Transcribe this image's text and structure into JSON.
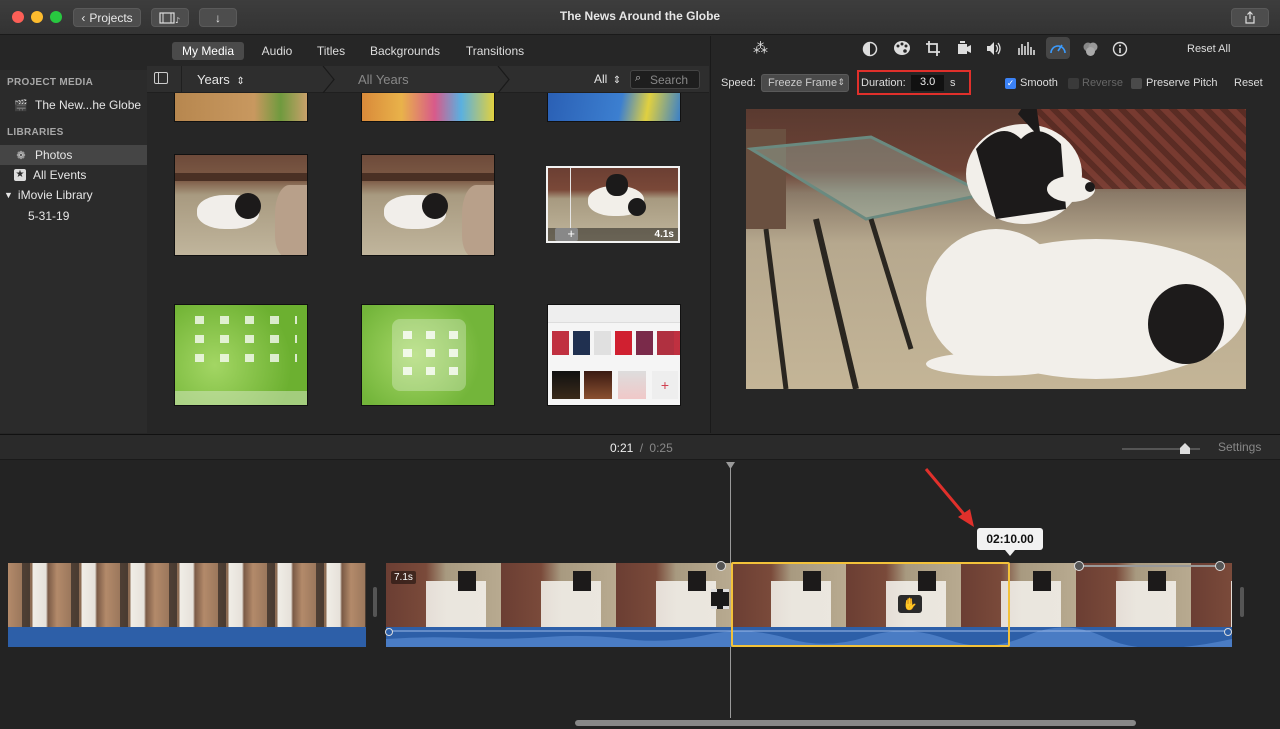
{
  "window": {
    "title": "The News Around the Globe",
    "projects_label": "Projects"
  },
  "browser": {
    "tabs": [
      "My Media",
      "Audio",
      "Titles",
      "Backgrounds",
      "Transitions"
    ],
    "active_tab": "My Media"
  },
  "sidebar": {
    "project_media_header": "PROJECT MEDIA",
    "project_item": "The New...he Globe",
    "libraries_header": "LIBRARIES",
    "photos": "Photos",
    "all_events": "All Events",
    "library": "iMovie Library",
    "event": "5-31-19"
  },
  "filter": {
    "years": "Years",
    "all_years": "All Years",
    "all": "All",
    "search_placeholder": "Search"
  },
  "thumbs": {
    "selected_duration": "4.1s"
  },
  "viewer": {
    "reset_all": "Reset All",
    "speed_label": "Speed:",
    "speed_value": "Freeze Frame",
    "duration_label": "Duration:",
    "duration_value": "3.0",
    "duration_unit": "s",
    "smooth": "Smooth",
    "reverse": "Reverse",
    "preserve_pitch": "Preserve Pitch",
    "reset": "Reset"
  },
  "timeline": {
    "current_time": "0:21",
    "separator": "/",
    "total_time": "0:25",
    "settings": "Settings",
    "clip_duration": "7.1s",
    "freeze_tooltip": "02:10.00"
  },
  "colors": {
    "highlight_red": "#e0302b",
    "selection_yellow": "#f3c23a",
    "audio_blue": "#2d5fa8",
    "accent_blue": "#3b82f6"
  }
}
